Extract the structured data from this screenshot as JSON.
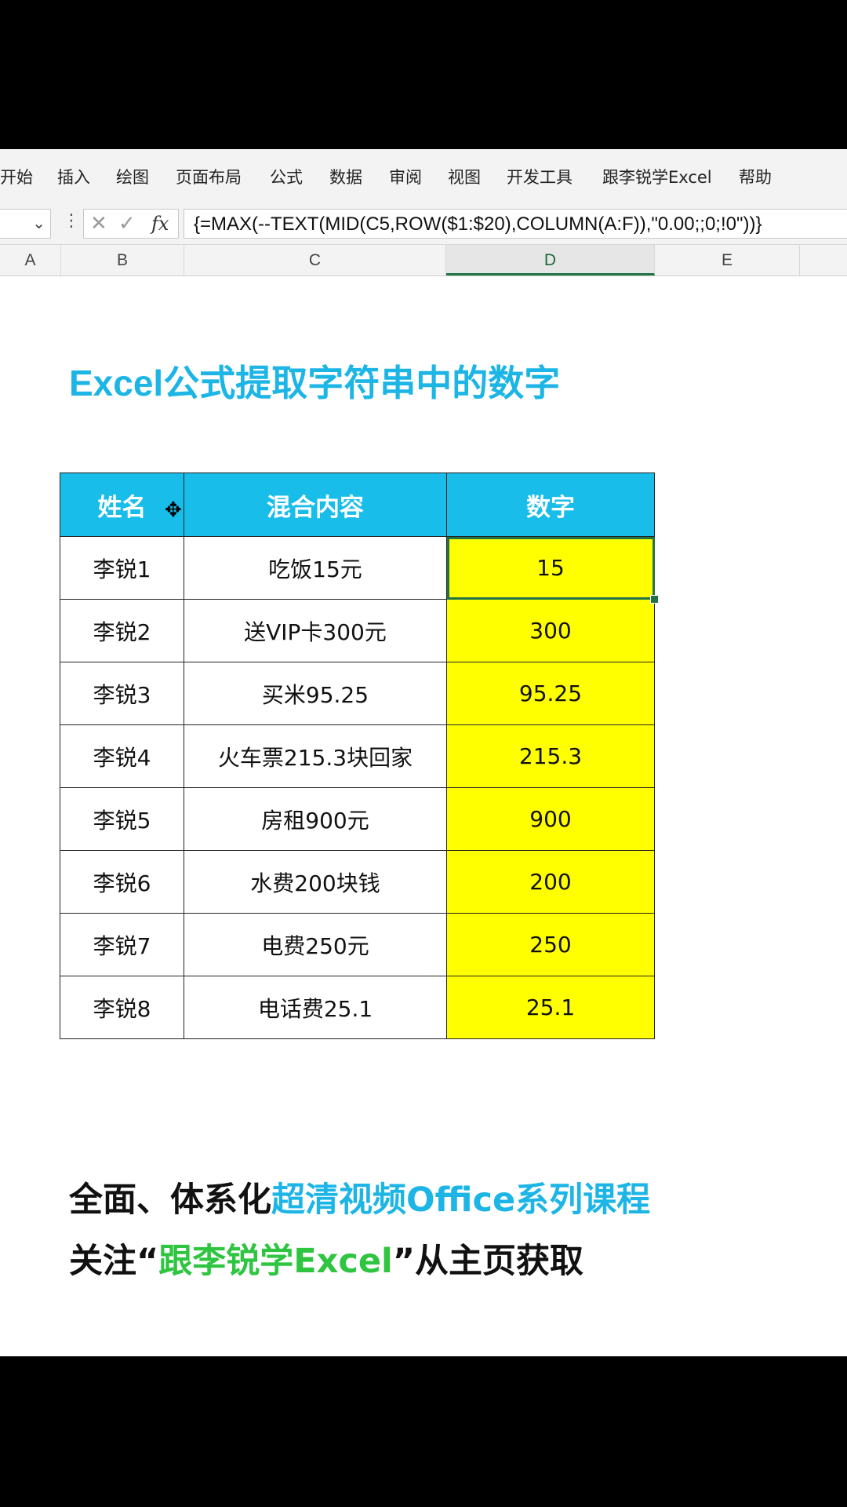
{
  "ribbon": {
    "tabs": [
      "开始",
      "插入",
      "绘图",
      "页面布局",
      "公式",
      "数据",
      "审阅",
      "视图",
      "开发工具",
      "跟李锐学Excel",
      "帮助"
    ]
  },
  "formula_bar": {
    "fx_label": "fx",
    "cancel_glyph": "✕",
    "enter_glyph": "✓",
    "formula": "{=MAX(--TEXT(MID(C5,ROW($1:$20),COLUMN(A:F)),\"0.00;;0;!0\"))}"
  },
  "columns": [
    "A",
    "B",
    "C",
    "D",
    "E"
  ],
  "sheet": {
    "title": "Excel公式提取字符串中的数字",
    "headers": [
      "姓名",
      "混合内容",
      "数字"
    ],
    "rows": [
      [
        "李锐1",
        "吃饭15元",
        "15"
      ],
      [
        "李锐2",
        "送VIP卡300元",
        "300"
      ],
      [
        "李锐3",
        "买米95.25",
        "95.25"
      ],
      [
        "李锐4",
        "火车票215.3块回家",
        "215.3"
      ],
      [
        "李锐5",
        "房租900元",
        "900"
      ],
      [
        "李锐6",
        "水费200块钱",
        "200"
      ],
      [
        "李锐7",
        "电费250元",
        "250"
      ],
      [
        "李锐8",
        "电话费25.1",
        "25.1"
      ]
    ]
  },
  "promo": {
    "line1_a": "全面、体系化",
    "line1_b": "超清视频Office系列课程",
    "line2_a": "关注“",
    "line2_b": "跟李锐学Excel",
    "line2_c": "”从主页获取"
  },
  "colors": {
    "header_bg": "#19bdea",
    "highlight": "#ffff00",
    "title": "#1cb5e6",
    "accent_green": "#2fc541",
    "excel_green": "#217346"
  }
}
